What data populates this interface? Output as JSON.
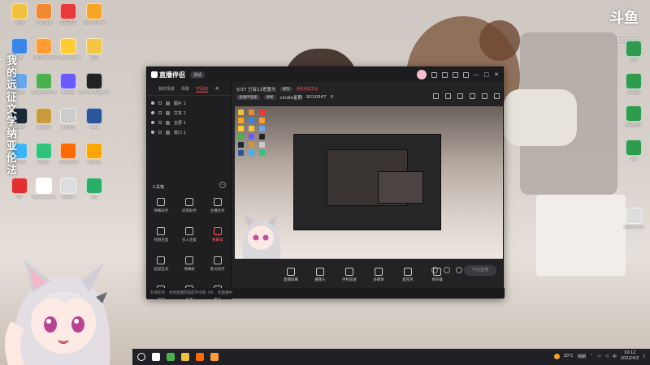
{
  "desktop": {
    "vertical_text": "我的远征文学纳亚伦法",
    "douyu_logo": "斗鱼",
    "douyu_id": "9210347",
    "left_icons": [
      {
        "label": "此电脑",
        "color": "#f0c040"
      },
      {
        "label": "小猫百宝箱",
        "color": "#f08a30"
      },
      {
        "label": "网易云音乐",
        "color": "#e83a3a"
      },
      {
        "label": "Steam Online",
        "color": "#f5a623"
      },
      {
        "label": "网络",
        "color": "#3a86e8"
      },
      {
        "label": "小猫百宝箱Wall",
        "color": "#ff9c33"
      },
      {
        "label": "EasyKeyboard",
        "color": "#ffcc33"
      },
      {
        "label": "桌面",
        "color": "#f5c543"
      },
      {
        "label": "回收站",
        "color": "#6aa7e8"
      },
      {
        "label": "Google Chrome",
        "color": "#4caf50"
      },
      {
        "label": "Shortcut",
        "color": "#6b5bff"
      },
      {
        "label": "Ethereal Wings Kit",
        "color": "#222222"
      },
      {
        "label": "Steam",
        "color": "#1b2838"
      },
      {
        "label": "英雄联盟",
        "color": "#c89b3c"
      },
      {
        "label": "文本文档",
        "color": "#cccccc"
      },
      {
        "label": "Word",
        "color": "#2b579a"
      },
      {
        "label": "腾讯QQ",
        "color": "#3bb5f5"
      },
      {
        "label": "QQ音乐",
        "color": "#31c27c"
      },
      {
        "label": "斗鱼直播伴侣",
        "color": "#ff6a00"
      },
      {
        "label": "虎牙直播",
        "color": "#ffa500"
      },
      {
        "label": "PDF",
        "color": "#e23030"
      },
      {
        "label": "Hayloopenmei",
        "color": "#ffffff"
      },
      {
        "label": "新建文本",
        "color": "#dddddd"
      },
      {
        "label": "微信",
        "color": "#2aae67"
      }
    ],
    "right_icons": [
      {
        "label": "文档",
        "color": "#2f9b4d"
      },
      {
        "label": "新建文档",
        "color": "#2f9b4d"
      },
      {
        "label": "新建数据表",
        "color": "#2f9b4d"
      },
      {
        "label": "文档",
        "color": "#2f9b4d"
      },
      {
        "label": "新建文本文档",
        "color": "#dddddd"
      }
    ]
  },
  "app": {
    "logo": "直播伴侣",
    "version": "测试",
    "sidebar": {
      "tabs": [
        "我的场景",
        "场景",
        "可添加"
      ],
      "active_tab": 2,
      "add_label": "+",
      "scenes": [
        "图片 1",
        "文本 1",
        "全屏 1",
        "窗口 1"
      ],
      "tools_title": "工具箱",
      "tools": [
        {
          "label": "弹幕助手",
          "red": false
        },
        {
          "label": "房管助手",
          "red": false
        },
        {
          "label": "主播任务",
          "red": false
        },
        {
          "label": "视频连麦",
          "red": false
        },
        {
          "label": "多人连麦",
          "red": false
        },
        {
          "label": "弹幕墙",
          "red": true
        },
        {
          "label": "超级互动",
          "red": false
        },
        {
          "label": "弹幕姬",
          "red": false
        },
        {
          "label": "歌词同步",
          "red": false
        },
        {
          "label": "新品",
          "red": false
        },
        {
          "label": "更多",
          "red": false
        },
        {
          "label": "关注",
          "red": false
        }
      ]
    },
    "info": {
      "stream_title": "0/37 已有11把置光",
      "edit_tag": "修改",
      "alert": "请先完成实名",
      "category_tag": "直播伴侣版",
      "quality_tag": "清晰",
      "user": "cindie星期",
      "room_id": "9210347",
      "fans": "0"
    },
    "controls": [
      {
        "label": "直播屏幕"
      },
      {
        "label": "摄像头"
      },
      {
        "label": "手机投屏"
      },
      {
        "label": "多媒体"
      },
      {
        "label": "麦克风"
      },
      {
        "label": "扬声器"
      }
    ],
    "start_button": "开始直播",
    "footer": [
      "礼物任务",
      "本周直播完成度平均值: 0%",
      "如直播中"
    ]
  },
  "taskbar": {
    "temperature": "20°C",
    "weather": "晴朗",
    "time": "19:12",
    "date": "2022/4/3",
    "apps": [
      {
        "name": "search",
        "color": "#ffffff"
      },
      {
        "name": "chrome",
        "color": "#4caf50"
      },
      {
        "name": "file-explorer",
        "color": "#f0c040"
      },
      {
        "name": "streamer",
        "color": "#ff6a00"
      },
      {
        "name": "app-orange",
        "color": "#ff9c33"
      }
    ]
  }
}
